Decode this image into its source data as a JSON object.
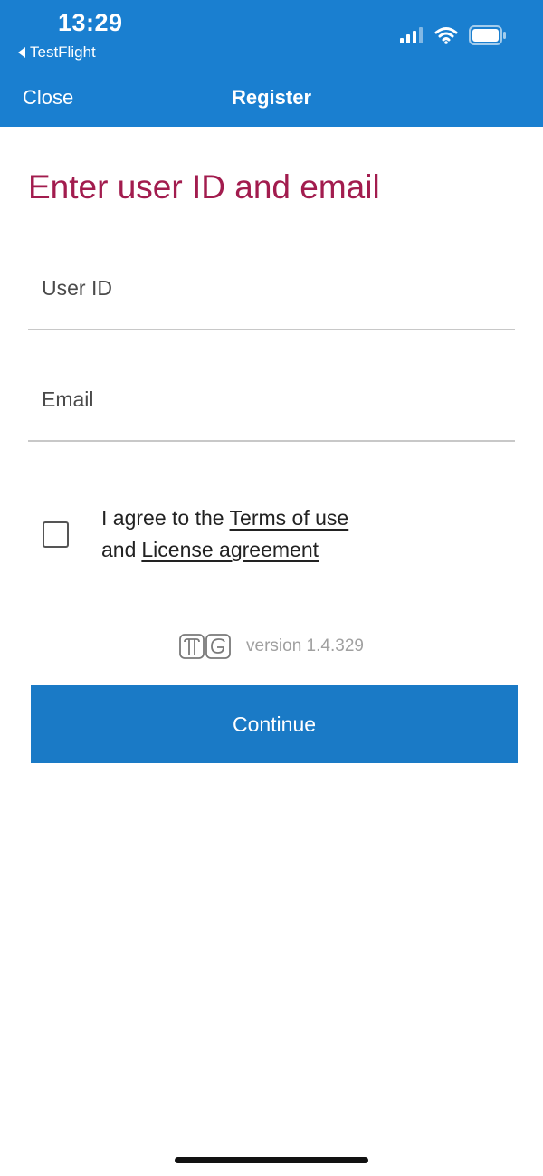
{
  "status_bar": {
    "time": "13:29",
    "back_app": "TestFlight"
  },
  "nav": {
    "close_label": "Close",
    "title": "Register"
  },
  "page": {
    "title": "Enter user ID and email"
  },
  "form": {
    "user_id_placeholder": "User ID",
    "user_id_value": "",
    "email_placeholder": "Email",
    "email_value": "",
    "agree_checked": false,
    "agree_prefix": "I agree to the",
    "terms_link": "Terms of use",
    "and_text": "and",
    "license_link": "License agreement"
  },
  "version": {
    "label": "version 1.4.329"
  },
  "actions": {
    "continue_label": "Continue"
  },
  "colors": {
    "header_bg": "#1a7fd0",
    "title": "#a21c4e",
    "button_bg": "#1a7ac6"
  },
  "icons": {
    "back": "back-triangle-icon",
    "signal": "cellular-signal-icon",
    "wifi": "wifi-icon",
    "battery": "battery-icon",
    "logo": "app-logo-icon"
  }
}
